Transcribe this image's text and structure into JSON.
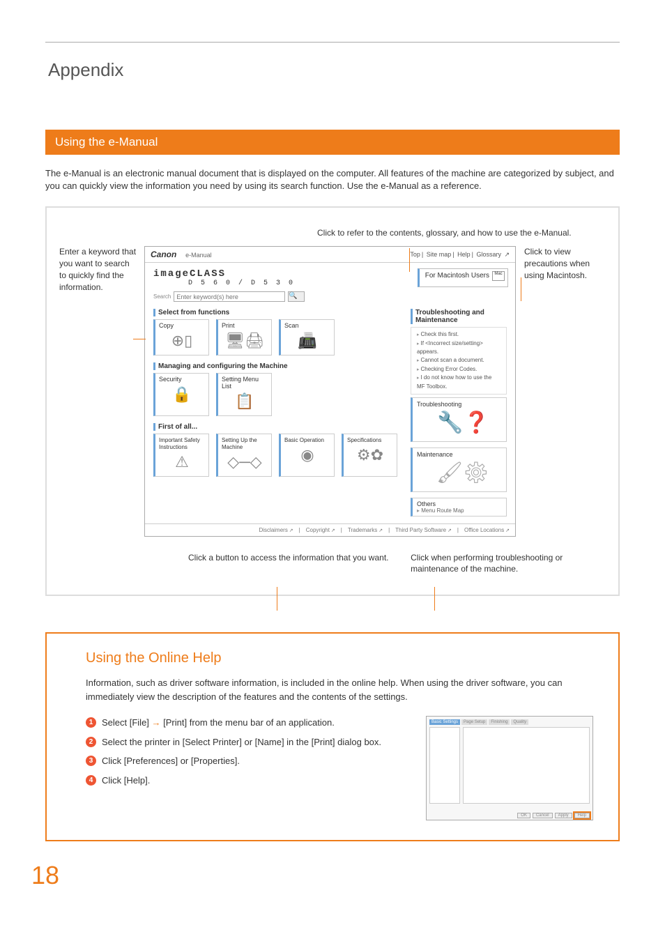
{
  "chapter_title": "Appendix",
  "section_title": "Using the e-Manual",
  "intro": "The e-Manual is an electronic manual document that is displayed on the computer. All features of the machine are categorized by subject, and you can quickly view the information you need by using its search function. Use the e-Manual as a reference.",
  "callouts": {
    "top": "Click to refer to the contents, glossary, and how to use the e-Manual.",
    "left": "Enter a keyword that you want to search to quickly find the information.",
    "right": "Click to view precautions when using Macintosh.",
    "bottom_left": "Click a button to access the information that you want.",
    "bottom_right": "Click when performing troubleshooting or maintenance of the machine."
  },
  "screenshot": {
    "logo": "Canon",
    "logo_sub": "e-Manual",
    "nav": [
      "Top",
      "Site map",
      "Help",
      "Glossary"
    ],
    "brand": "imageCLASS",
    "model": "D 5 6 0 / D 5 3 0",
    "mac": "For Macintosh Users",
    "mac_badge": "Mac",
    "search_label": "Search",
    "search_placeholder": "Enter keyword(s) here",
    "left_panel_head1": "Select from functions",
    "tiles1": [
      "Copy",
      "Print",
      "Scan"
    ],
    "left_panel_head2": "Managing and configuring the Machine",
    "tiles2": [
      "Security",
      "Setting Menu List"
    ],
    "left_panel_head3": "First of all...",
    "tiles3": [
      "Important Safety Instructions",
      "Setting Up the Machine",
      "Basic Operation",
      "Specifications"
    ],
    "right_panel_head": "Troubleshooting and Maintenance",
    "trouble_items": [
      "Check this first.",
      "If <Incorrect size/setting> appears.",
      "Cannot scan a document.",
      "Checking Error Codes.",
      "I do not know how to use the MF Toolbox."
    ],
    "bigtile1": "Troubleshooting",
    "bigtile2": "Maintenance",
    "others": "Others",
    "others_sub": "Menu Route Map",
    "footer": [
      "Disclaimers",
      "Copyright",
      "Trademarks",
      "Third Party Software",
      "Office Locations"
    ]
  },
  "help": {
    "title": "Using the Online Help",
    "intro": "Information, such as driver software information, is included in the online help. When using the driver software, you can immediately view the description of the features and the contents of the settings.",
    "steps": [
      {
        "n": "1",
        "pre": "Select [File] ",
        "arrow": "→",
        "post": " [Print] from the menu bar of an application."
      },
      {
        "n": "2",
        "pre": "Select the printer in [Select Printer] or [Name] in the [Print] dialog box.",
        "arrow": "",
        "post": ""
      },
      {
        "n": "3",
        "pre": "Click [Preferences] or [Properties].",
        "arrow": "",
        "post": ""
      },
      {
        "n": "4",
        "pre": "Click [Help].",
        "arrow": "",
        "post": ""
      }
    ],
    "dialog_tabs": [
      "Basic Settings",
      "Page Setup",
      "Finishing",
      "Quality"
    ],
    "dialog_buttons": [
      "OK",
      "Cancel",
      "Apply",
      "Help"
    ]
  },
  "page_number": "18"
}
